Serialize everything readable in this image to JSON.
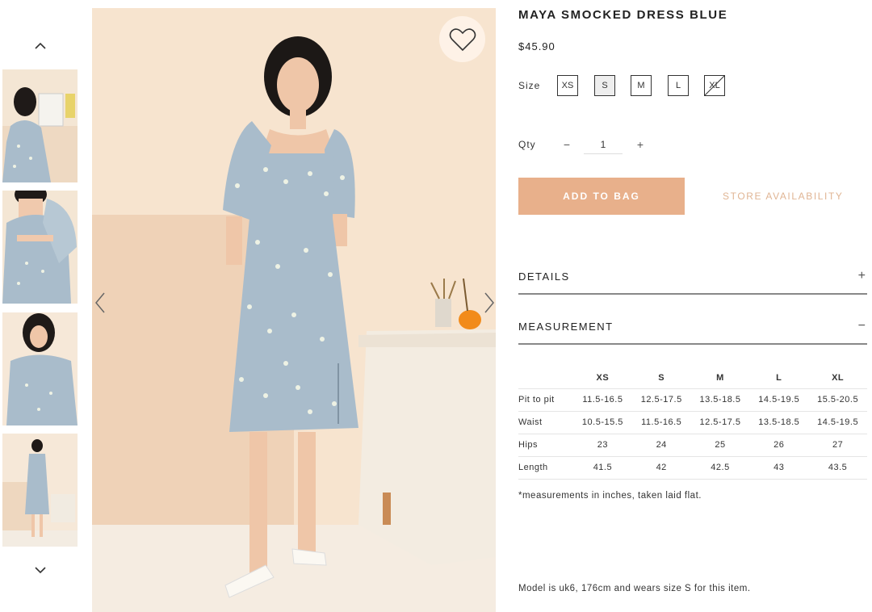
{
  "product": {
    "title": "MAYA SMOCKED DRESS BLUE",
    "price": "$45.90"
  },
  "size_selector": {
    "label": "Size",
    "options": [
      {
        "label": "XS",
        "state": "available"
      },
      {
        "label": "S",
        "state": "selected"
      },
      {
        "label": "M",
        "state": "available"
      },
      {
        "label": "L",
        "state": "available"
      },
      {
        "label": "XL",
        "state": "unavailable"
      }
    ]
  },
  "quantity": {
    "label": "Qty",
    "minus": "−",
    "value": "1",
    "plus": "+"
  },
  "actions": {
    "add_to_bag": "ADD TO BAG",
    "store_availability": "STORE AVAILABILITY"
  },
  "accordions": {
    "details": {
      "title": "DETAILS",
      "icon": "+"
    },
    "measurement": {
      "title": "MEASUREMENT",
      "icon": "−"
    }
  },
  "measurement_table": {
    "headers": [
      "",
      "XS",
      "S",
      "M",
      "L",
      "XL"
    ],
    "rows": [
      [
        "Pit to pit",
        "11.5-16.5",
        "12.5-17.5",
        "13.5-18.5",
        "14.5-19.5",
        "15.5-20.5"
      ],
      [
        "Waist",
        "10.5-15.5",
        "11.5-16.5",
        "12.5-17.5",
        "13.5-18.5",
        "14.5-19.5"
      ],
      [
        "Hips",
        "23",
        "24",
        "25",
        "26",
        "27"
      ],
      [
        "Length",
        "41.5",
        "42",
        "42.5",
        "43",
        "43.5"
      ]
    ]
  },
  "notes": {
    "measurement_note": "*measurements in inches, taken laid flat.",
    "model_note": "Model is uk6, 176cm and wears size S for this item."
  },
  "gallery": {
    "thumbnail_count": 4,
    "icons": [
      "chevron-up-icon",
      "chevron-down-icon",
      "chevron-left-icon",
      "chevron-right-icon",
      "heart-icon"
    ]
  },
  "colors": {
    "accent": "#e8b08b",
    "store_link": "#e0b594",
    "dress": "#a9bccb",
    "backdrop": "#f7e4cf"
  }
}
